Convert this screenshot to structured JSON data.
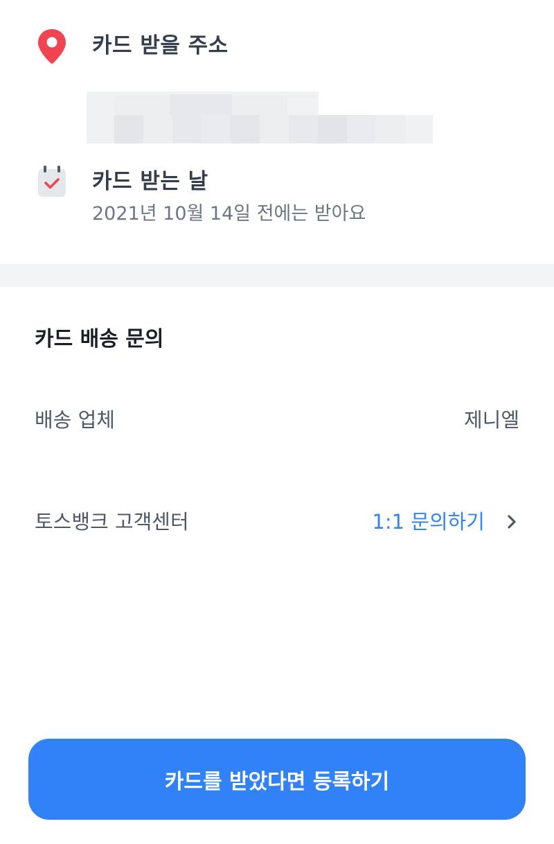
{
  "address": {
    "title": "카드 받을 주소",
    "icon": "location-pin-icon",
    "value_redacted": true
  },
  "delivery_date": {
    "title": "카드 받는 날",
    "subtitle": "2021년 10월 14일 전에는 받아요",
    "icon": "calendar-check-icon"
  },
  "inquiry_section": {
    "title": "카드 배송 문의",
    "carrier": {
      "label": "배송 업체",
      "value": "제니엘"
    },
    "support": {
      "label": "토스뱅크 고객센터",
      "link": "1:1 문의하기",
      "icon": "chevron-right-icon"
    }
  },
  "cta": {
    "label": "카드를 받았다면 등록하기"
  },
  "colors": {
    "accent": "#3182f6",
    "pin_red": "#f04452",
    "title_text": "#333d4b",
    "sub_text": "#6b7684",
    "divider": "#f2f4f6"
  }
}
